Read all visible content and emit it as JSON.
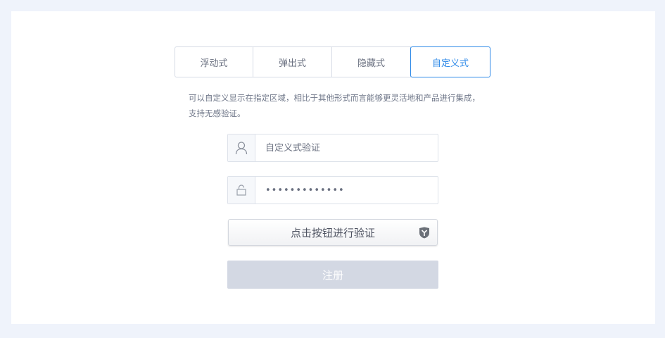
{
  "tabs": [
    {
      "label": "浮动式"
    },
    {
      "label": "弹出式"
    },
    {
      "label": "隐藏式"
    },
    {
      "label": "自定义式"
    }
  ],
  "active_tab": 3,
  "description": "可以自定义显示在指定区域，相比于其他形式而言能够更灵活地和产品进行集成，支持无感验证。",
  "username": {
    "placeholder": "自定义式验证",
    "icon": "user-icon"
  },
  "password": {
    "value": "•••••••••••••",
    "icon": "lock-icon"
  },
  "verify_button": {
    "label": "点击按钮进行验证",
    "icon": "shield-logo-icon"
  },
  "submit_button": {
    "label": "注册"
  },
  "colors": {
    "accent": "#2f8ae8",
    "page_bg": "#eff3fb",
    "submit_disabled": "#d3d8e3"
  }
}
